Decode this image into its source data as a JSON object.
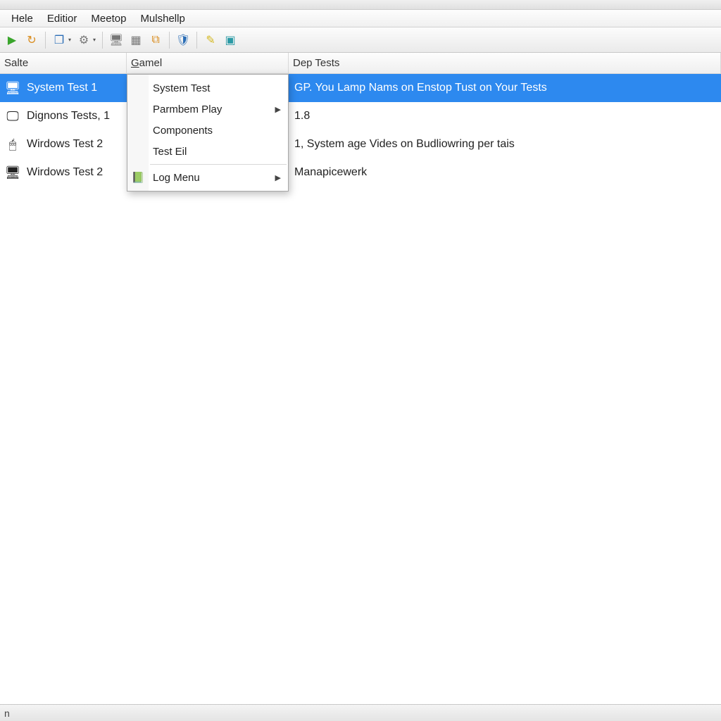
{
  "menubar": {
    "items": [
      "Hele",
      "Editior",
      "Meetop",
      "Mulshellp"
    ]
  },
  "toolbar_icons": [
    {
      "name": "play-icon",
      "glyph": "▶",
      "cls": "ic-green",
      "dd": false
    },
    {
      "name": "refresh-icon",
      "glyph": "↻",
      "cls": "ic-orange",
      "dd": false
    },
    {
      "sep": true
    },
    {
      "name": "stack-icon",
      "glyph": "❐",
      "cls": "ic-blue",
      "dd": true
    },
    {
      "name": "gear-icon",
      "glyph": "⚙",
      "cls": "ic-grey",
      "dd": true
    },
    {
      "sep": true
    },
    {
      "name": "computer-icon",
      "glyph": "🖥",
      "cls": "ic-grey",
      "dd": false
    },
    {
      "name": "grid-icon",
      "glyph": "▦",
      "cls": "ic-grey",
      "dd": false
    },
    {
      "name": "copy-icon",
      "glyph": "⧉",
      "cls": "ic-orange",
      "dd": false
    },
    {
      "sep": true
    },
    {
      "name": "shield-icon",
      "glyph": "🛡",
      "cls": "ic-blue",
      "dd": false
    },
    {
      "sep": true
    },
    {
      "name": "brush-icon",
      "glyph": "✎",
      "cls": "ic-yellow",
      "dd": false
    },
    {
      "name": "panel-icon",
      "glyph": "▣",
      "cls": "ic-teal",
      "dd": false
    }
  ],
  "columns": {
    "salte": "Salte",
    "gamel": "Gamel",
    "gamel_underline": "G",
    "dep": "Dep Tests"
  },
  "rows": [
    {
      "icon": "🖥",
      "salte": "System Test  1",
      "dep": "GP. You Lamp Nams on Enstop Tust on Your Tests",
      "selected": true
    },
    {
      "icon": "🖵",
      "salte": "Dignons Tests, 1",
      "dep": "1.8",
      "selected": false
    },
    {
      "icon": "🖱",
      "salte": "Wirdows Test 2",
      "dep": "1, System age Vides on Budliowring per tais",
      "selected": false
    },
    {
      "icon": "🖥",
      "salte": "Wirdows Test 2",
      "dep": "Manapicewerk",
      "selected": false
    }
  ],
  "context_menu": {
    "items": [
      {
        "label": "System Test",
        "submenu": false,
        "icon": ""
      },
      {
        "label": "Parmbem Play",
        "submenu": true,
        "icon": ""
      },
      {
        "label": "Components",
        "submenu": false,
        "icon": ""
      },
      {
        "label": "Test Eil",
        "submenu": false,
        "icon": ""
      },
      {
        "sep": true
      },
      {
        "label": "Log Menu",
        "submenu": true,
        "icon": "📗"
      }
    ]
  },
  "statusbar": {
    "text": "n"
  }
}
